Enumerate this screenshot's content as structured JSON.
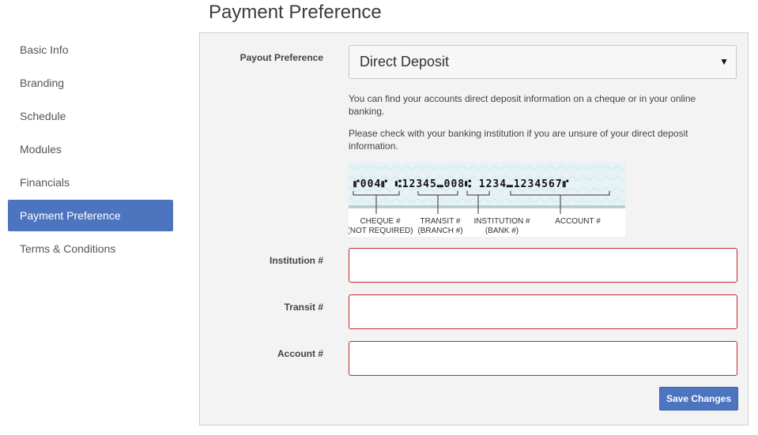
{
  "page": {
    "title": "Payment Preference"
  },
  "sidebar": {
    "items": [
      {
        "label": "Basic Info"
      },
      {
        "label": "Branding"
      },
      {
        "label": "Schedule"
      },
      {
        "label": "Modules"
      },
      {
        "label": "Financials"
      },
      {
        "label": "Payment Preference",
        "active": true
      },
      {
        "label": "Terms & Conditions"
      }
    ]
  },
  "form": {
    "payout_label": "Payout Preference",
    "payout_value": "Direct Deposit",
    "help_1": "You can find your accounts direct deposit information on a cheque or in your online banking.",
    "help_2": "Please check with your banking institution if you are unsure of your direct deposit information.",
    "cheque": {
      "micr": "⑈004⑈ ⑆12345⑉008⑆ 1234⑉1234567⑈",
      "labels": {
        "cheque": "CHEQUE #",
        "cheque_sub": "(NOT REQUIRED)",
        "transit": "TRANSIT #",
        "transit_sub": "(BRANCH #)",
        "institution": "INSTITUTION #",
        "institution_sub": "(BANK #)",
        "account": "ACCOUNT #"
      }
    },
    "institution_label": "Institution #",
    "transit_label": "Transit #",
    "account_label": "Account #",
    "institution_value": "",
    "transit_value": "",
    "account_value": "",
    "save_label": "Save Changes"
  },
  "colors": {
    "accent": "#4d74bf",
    "error_border": "#c0292c",
    "panel_bg": "#f3f3f3"
  }
}
